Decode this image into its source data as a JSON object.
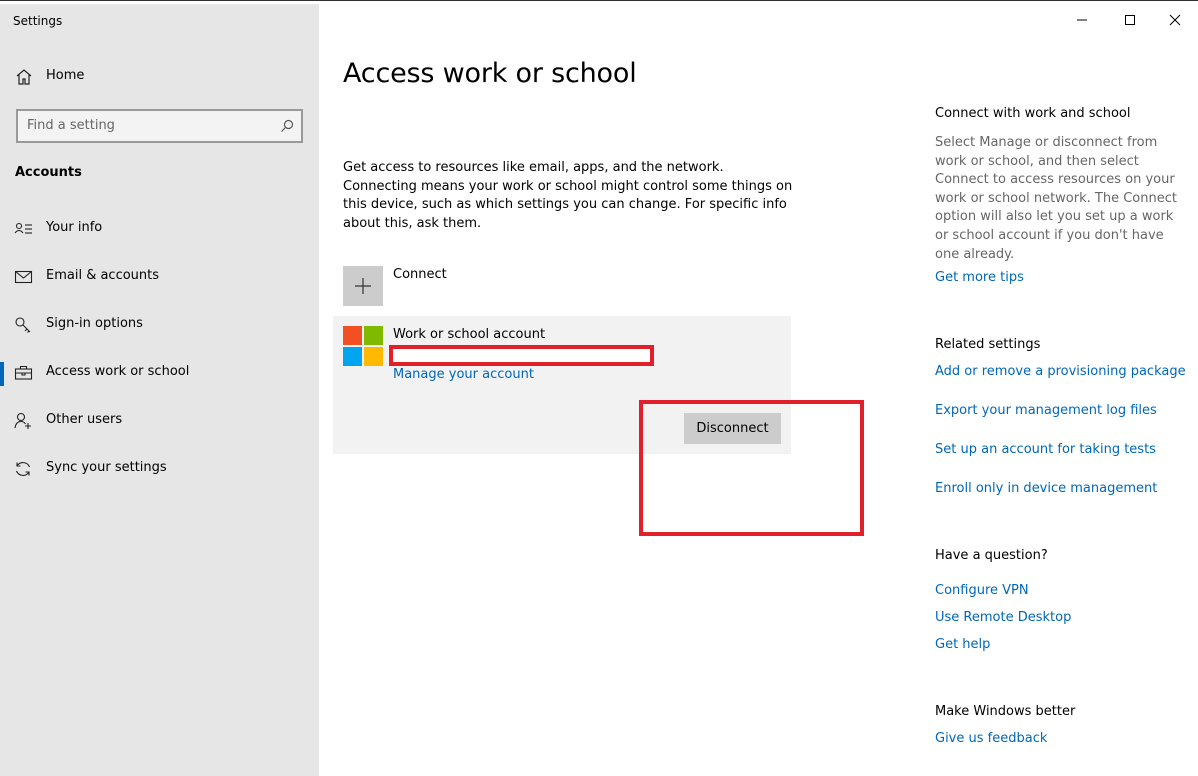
{
  "window": {
    "title": "Settings",
    "controls": {
      "minimize": "minimize-icon",
      "maximize": "maximize-icon",
      "close": "close-icon"
    }
  },
  "sidebar": {
    "home_label": "Home",
    "search_placeholder": "Find a setting",
    "section_label": "Accounts",
    "items": [
      {
        "label": "Your info",
        "icon": "person-card-icon"
      },
      {
        "label": "Email & accounts",
        "icon": "mail-icon"
      },
      {
        "label": "Sign-in options",
        "icon": "key-icon"
      },
      {
        "label": "Access work or school",
        "icon": "briefcase-icon",
        "active": true
      },
      {
        "label": "Other users",
        "icon": "add-person-icon"
      },
      {
        "label": "Sync your settings",
        "icon": "sync-icon"
      }
    ]
  },
  "main": {
    "title": "Access work or school",
    "description": "Get access to resources like email, apps, and the network. Connecting means your work or school might control some things on this device, such as which settings you can change. For specific info about this, ask them.",
    "connect_label": "Connect",
    "account": {
      "label": "Work or school account",
      "manage_link": "Manage your account",
      "disconnect_label": "Disconnect"
    }
  },
  "right_panel": {
    "connect_title": "Connect with work and school",
    "connect_text": "Select Manage or disconnect from work or school, and then select Connect to access resources on your work or school network. The Connect option will also let you set up a work or school account if you don't have one already.",
    "tips_link": "Get more tips",
    "related_title": "Related settings",
    "related_links": [
      "Add or remove a provisioning package",
      "Export your management log files",
      "Set up an account for taking tests",
      "Enroll only in device management"
    ],
    "question_title": "Have a question?",
    "question_links": [
      "Configure VPN",
      "Use Remote Desktop",
      "Get help"
    ],
    "better_title": "Make Windows better",
    "feedback_link": "Give us feedback"
  },
  "colors": {
    "accent": "#0067b8",
    "annotation_red": "#e0202a",
    "sidebar_bg": "#e6e6e6"
  }
}
